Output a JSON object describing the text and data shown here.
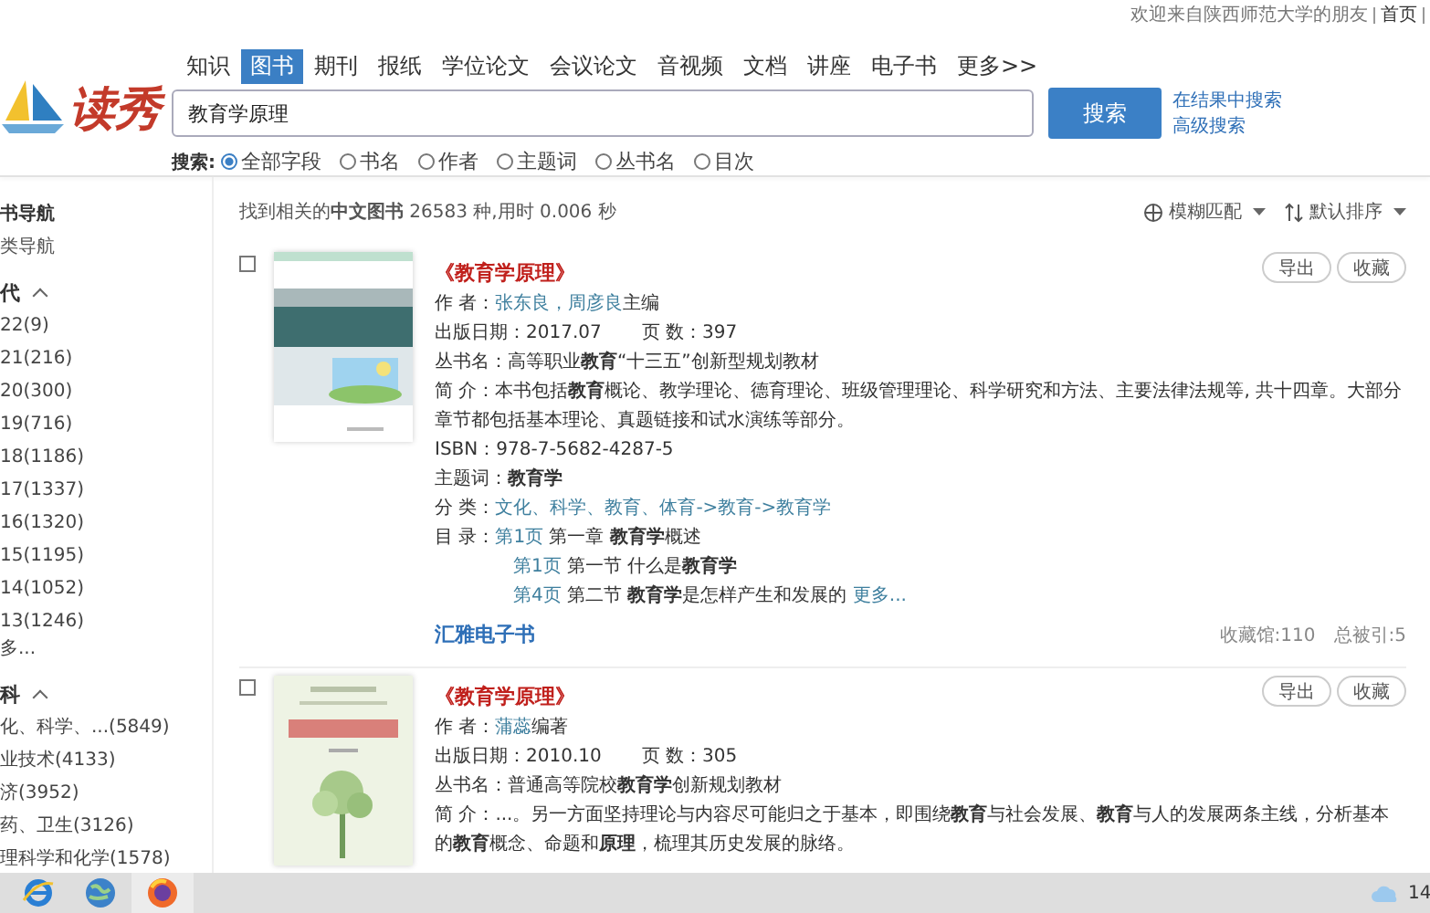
{
  "header": {
    "welcome": "欢迎来自陕西师范大学的朋友",
    "links": [
      "首页"
    ],
    "logo_text": "读秀"
  },
  "tabs": [
    {
      "label": "知识",
      "selected": false
    },
    {
      "label": "图书",
      "selected": true
    },
    {
      "label": "期刊",
      "selected": false
    },
    {
      "label": "报纸",
      "selected": false
    },
    {
      "label": "学位论文",
      "selected": false
    },
    {
      "label": "会议论文",
      "selected": false
    },
    {
      "label": "音视频",
      "selected": false
    },
    {
      "label": "文档",
      "selected": false
    },
    {
      "label": "讲座",
      "selected": false
    },
    {
      "label": "电子书",
      "selected": false
    },
    {
      "label": "更多>>",
      "selected": false
    }
  ],
  "search": {
    "value": "教育学原理",
    "button": "搜索",
    "links": [
      "在结果中搜索",
      "高级搜索"
    ]
  },
  "search_fields": {
    "label": "搜索:",
    "options": [
      {
        "label": "全部字段",
        "selected": true
      },
      {
        "label": "书名",
        "selected": false
      },
      {
        "label": "作者",
        "selected": false
      },
      {
        "label": "主题词",
        "selected": false
      },
      {
        "label": "丛书名",
        "selected": false
      },
      {
        "label": "目次",
        "selected": false
      }
    ]
  },
  "sidebar": {
    "title": "书导航",
    "link": "类导航",
    "groups": [
      {
        "heading": "代",
        "expanded": true,
        "items": [
          "22(9)",
          "21(216)",
          "20(300)",
          "19(716)",
          "18(1186)",
          "17(1337)",
          "16(1320)",
          "15(1195)",
          "14(1052)",
          "13(1246)"
        ],
        "more": "多..."
      },
      {
        "heading": "科",
        "expanded": true,
        "items": [
          "化、科学、...(5849)",
          "业技术(4133)",
          "济(3952)",
          "药、卫生(3126)",
          "理科学和化学(1578)"
        ]
      }
    ]
  },
  "summary": "找到相关的**中文图书** 26583 种,用时 0.006 秒",
  "sort": [
    {
      "label": "模糊匹配",
      "kind": "match"
    },
    {
      "label": "默认排序",
      "kind": "order"
    }
  ],
  "results": [
    {
      "checked": false,
      "cover": {
        "kind": "picture"
      },
      "title": "《教育学原理》",
      "actions": [
        "导出",
        "收藏"
      ],
      "fields": [
        {
          "label": "作 者：",
          "lines": [
            [
              {
                "text": "张东良，周彦良",
                "link": true
              },
              {
                "text": "主编",
                "link": false
              }
            ]
          ]
        },
        {
          "label": "出版日期：",
          "lines": [
            [
              {
                "text": "2017.07",
                "link": false
              }
            ]
          ],
          "extra": {
            "label": "页 数：",
            "text": "397"
          }
        },
        {
          "label": "丛书名：",
          "lines": [
            [
              {
                "text": "高等职业**教育**“十三五”创新型规划教材",
                "link": false
              }
            ]
          ]
        },
        {
          "label": "简 介：",
          "lines": [
            [
              {
                "text": "本书包括**教育**概论、教学理论、德育理论、班级管理理论、科学研究和方法、主要法律法规等, 共十四章。大部分章节都包括基本理论、真题链接和试水演练等部分。",
                "link": false
              }
            ]
          ]
        },
        {
          "label": "ISBN：",
          "lines": [
            [
              {
                "text": "978-7-5682-4287-5",
                "link": false
              }
            ]
          ]
        },
        {
          "label": "主题词：",
          "lines": [
            [
              {
                "text": "**教育学**",
                "link": false
              }
            ]
          ]
        },
        {
          "label": "分 类：",
          "lines": [
            [
              {
                "text": "文化、科学、教育、体育->教育->教育学",
                "link": true
              }
            ]
          ]
        },
        {
          "label": "目 录：",
          "lines": [
            [
              {
                "text": "第1页",
                "link": true
              },
              {
                "text": " 第一章 **教育学**概述",
                "link": false
              }
            ],
            [
              {
                "text": "第1页",
                "link": true
              },
              {
                "text": " 第一节 什么是**教育学**",
                "link": false
              }
            ],
            [
              {
                "text": "第4页",
                "link": true
              },
              {
                "text": " 第二节 **教育学**是怎样产生和发展的 ",
                "link": false
              },
              {
                "text": "更多...",
                "link": true
              }
            ]
          ]
        }
      ],
      "source": "汇雅电子书",
      "stats": [
        "收藏馆:110",
        "总被引:5"
      ]
    },
    {
      "checked": false,
      "cover": {
        "kind": "picture"
      },
      "title": "《教育学原理》",
      "actions": [
        "导出",
        "收藏"
      ],
      "fields": [
        {
          "label": "作 者：",
          "lines": [
            [
              {
                "text": "蒲蕊",
                "link": true
              },
              {
                "text": "编著",
                "link": false
              }
            ]
          ]
        },
        {
          "label": "出版日期：",
          "lines": [
            [
              {
                "text": "2010.10",
                "link": false
              }
            ]
          ],
          "extra": {
            "label": "页 数：",
            "text": "305"
          }
        },
        {
          "label": "丛书名：",
          "lines": [
            [
              {
                "text": "普通高等院校**教育学**创新规划教材",
                "link": false
              }
            ]
          ]
        },
        {
          "label": "简 介：",
          "lines": [
            [
              {
                "text": "...。另一方面坚持理论与内容尽可能归之于基本，即围绕**教育**与社会发展、**教育**与人的发展两条主线，分析基本的**教育**概念、命题和**原理**，梳理其历史发展的脉络。",
                "link": false
              }
            ]
          ]
        }
      ]
    }
  ],
  "taskbar": {
    "clock": "14"
  }
}
